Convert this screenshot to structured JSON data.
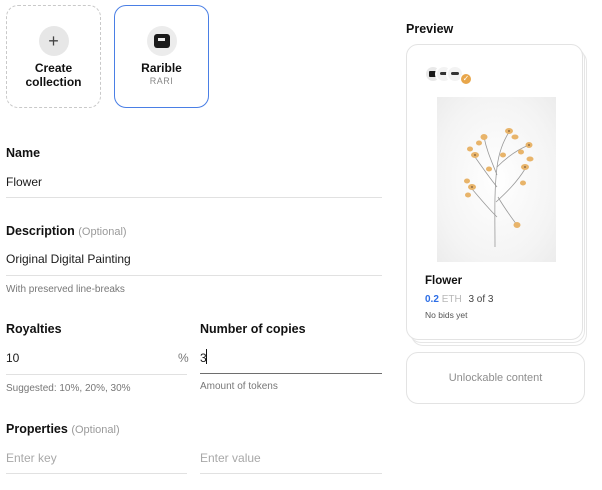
{
  "collections": {
    "create": {
      "plus": "+",
      "label_line1": "Create",
      "label_line2": "collection"
    },
    "rarible": {
      "label": "Rarible",
      "symbol": "RARI"
    }
  },
  "form": {
    "name": {
      "label": "Name",
      "value": "Flower"
    },
    "description": {
      "label": "Description",
      "optional": "(Optional)",
      "value": "Original Digital Painting",
      "hint": "With preserved line-breaks"
    },
    "royalties": {
      "label": "Royalties",
      "value": "10",
      "unit": "%",
      "hint": "Suggested: 10%, 20%, 30%"
    },
    "copies": {
      "label": "Number of copies",
      "value": "3",
      "hint": "Amount of tokens"
    },
    "properties": {
      "label": "Properties",
      "optional": "(Optional)",
      "key_placeholder": "Enter key",
      "value_placeholder": "Enter value"
    }
  },
  "preview": {
    "title": "Preview",
    "card": {
      "name": "Flower",
      "price": "0.2",
      "currency": "ETH",
      "copies": "3 of 3",
      "bids": "No bids yet"
    },
    "unlockable": "Unlockable content"
  },
  "colors": {
    "accent": "#2d6ee6",
    "selected_border": "#4a7fe5",
    "flower_petal": "#e8b46a"
  }
}
